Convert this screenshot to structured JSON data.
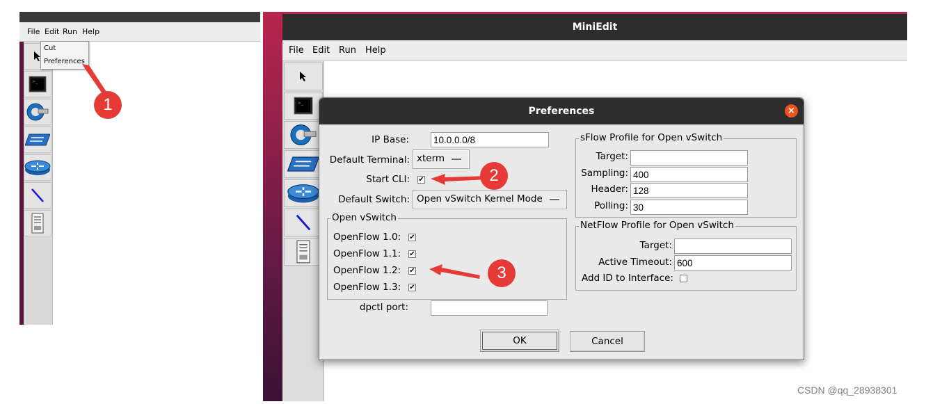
{
  "left_panel": {
    "menu": [
      "File",
      "Edit",
      "Run",
      "Help"
    ],
    "context_menu": [
      "Cut",
      "Preferences"
    ],
    "tools": [
      "select-icon",
      "host-icon",
      "controller-icon",
      "switch-icon",
      "router-icon",
      "link-icon",
      "netlink-icon"
    ],
    "annotation": "1"
  },
  "window": {
    "title": "MiniEdit",
    "menu": [
      "File",
      "Edit",
      "Run",
      "Help"
    ],
    "tools": [
      "select-icon",
      "host-icon",
      "controller-icon",
      "switch-icon",
      "router-icon",
      "link-icon",
      "netlink-icon"
    ]
  },
  "dialog": {
    "title": "Preferences",
    "ip_base": {
      "label": "IP Base:",
      "value": "10.0.0.0/8"
    },
    "default_terminal": {
      "label": "Default Terminal:",
      "value": "xterm"
    },
    "start_cli": {
      "label": "Start CLI:",
      "checked": true
    },
    "default_switch": {
      "label": "Default Switch:",
      "value": "Open vSwitch Kernel Mode"
    },
    "ovs_group": {
      "title": "Open vSwitch",
      "items": [
        {
          "label": "OpenFlow 1.0:",
          "checked": true
        },
        {
          "label": "OpenFlow 1.1:",
          "checked": true
        },
        {
          "label": "OpenFlow 1.2:",
          "checked": true
        },
        {
          "label": "OpenFlow 1.3:",
          "checked": true
        }
      ]
    },
    "dpctl_port": {
      "label": "dpctl port:",
      "value": ""
    },
    "sflow": {
      "title": "sFlow Profile for Open vSwitch",
      "target": {
        "label": "Target:",
        "value": ""
      },
      "sampling": {
        "label": "Sampling:",
        "value": "400"
      },
      "header": {
        "label": "Header:",
        "value": "128"
      },
      "polling": {
        "label": "Polling:",
        "value": "30"
      }
    },
    "netflow": {
      "title": "NetFlow Profile for Open vSwitch",
      "target": {
        "label": "Target:",
        "value": ""
      },
      "active_timeout": {
        "label": "Active Timeout:",
        "value": "600"
      },
      "add_id": {
        "label": "Add ID to Interface:",
        "checked": false
      }
    },
    "ok_label": "OK",
    "cancel_label": "Cancel"
  },
  "annotations": [
    "2",
    "3"
  ],
  "watermark": "CSDN @qq_28938301",
  "colors": {
    "annotation_red": "#e53a35",
    "close_orange": "#e95420",
    "title_dark": "#2d2d2d"
  }
}
